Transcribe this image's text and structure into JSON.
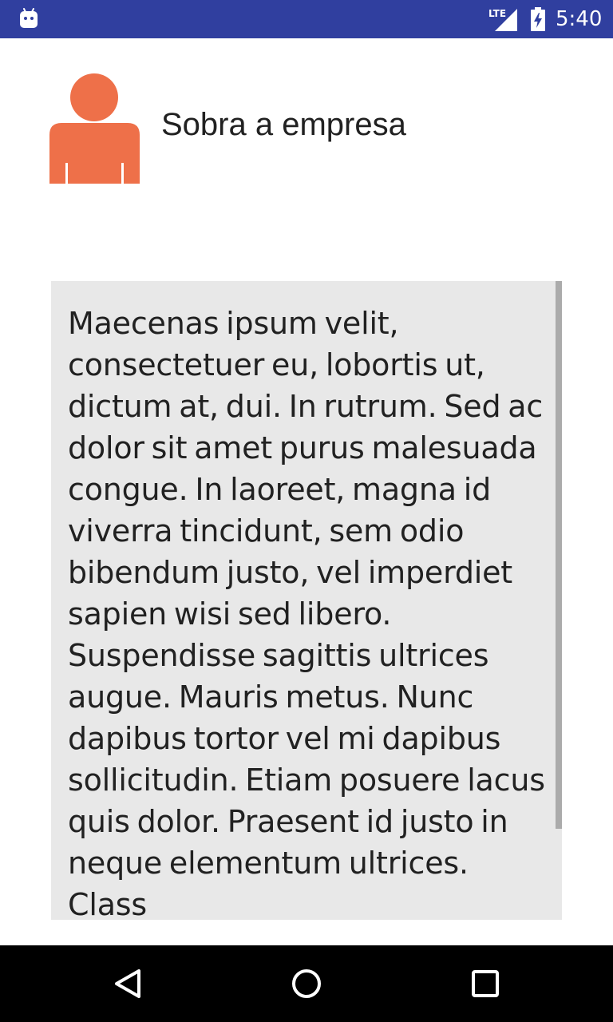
{
  "status_bar": {
    "background": "#303f9f",
    "app_icon": "android-icon",
    "network_label": "LTE",
    "battery_icon": "battery-charging-icon",
    "time": "5:40"
  },
  "header": {
    "avatar_icon": "person-icon",
    "avatar_color": "#ee7049",
    "title": "Sobra a empresa"
  },
  "content": {
    "background": "#e8e8e8",
    "text": "Maecenas ipsum velit, consectetuer eu, lobortis ut, dictum at, dui. In rutrum. Sed ac dolor sit amet purus malesuada congue. In laoreet, magna id viverra tincidunt, sem odio bibendum justo, vel imperdiet sapien wisi sed libero. Suspendisse sagittis ultrices augue. Mauris metus. Nunc dapibus tortor vel mi dapibus sollicitudin. Etiam posuere lacus quis dolor. Praesent id justo in neque elementum ultrices. Class"
  },
  "nav_bar": {
    "back_icon": "back-triangle-icon",
    "home_icon": "home-circle-icon",
    "recent_icon": "recent-apps-square-icon"
  }
}
